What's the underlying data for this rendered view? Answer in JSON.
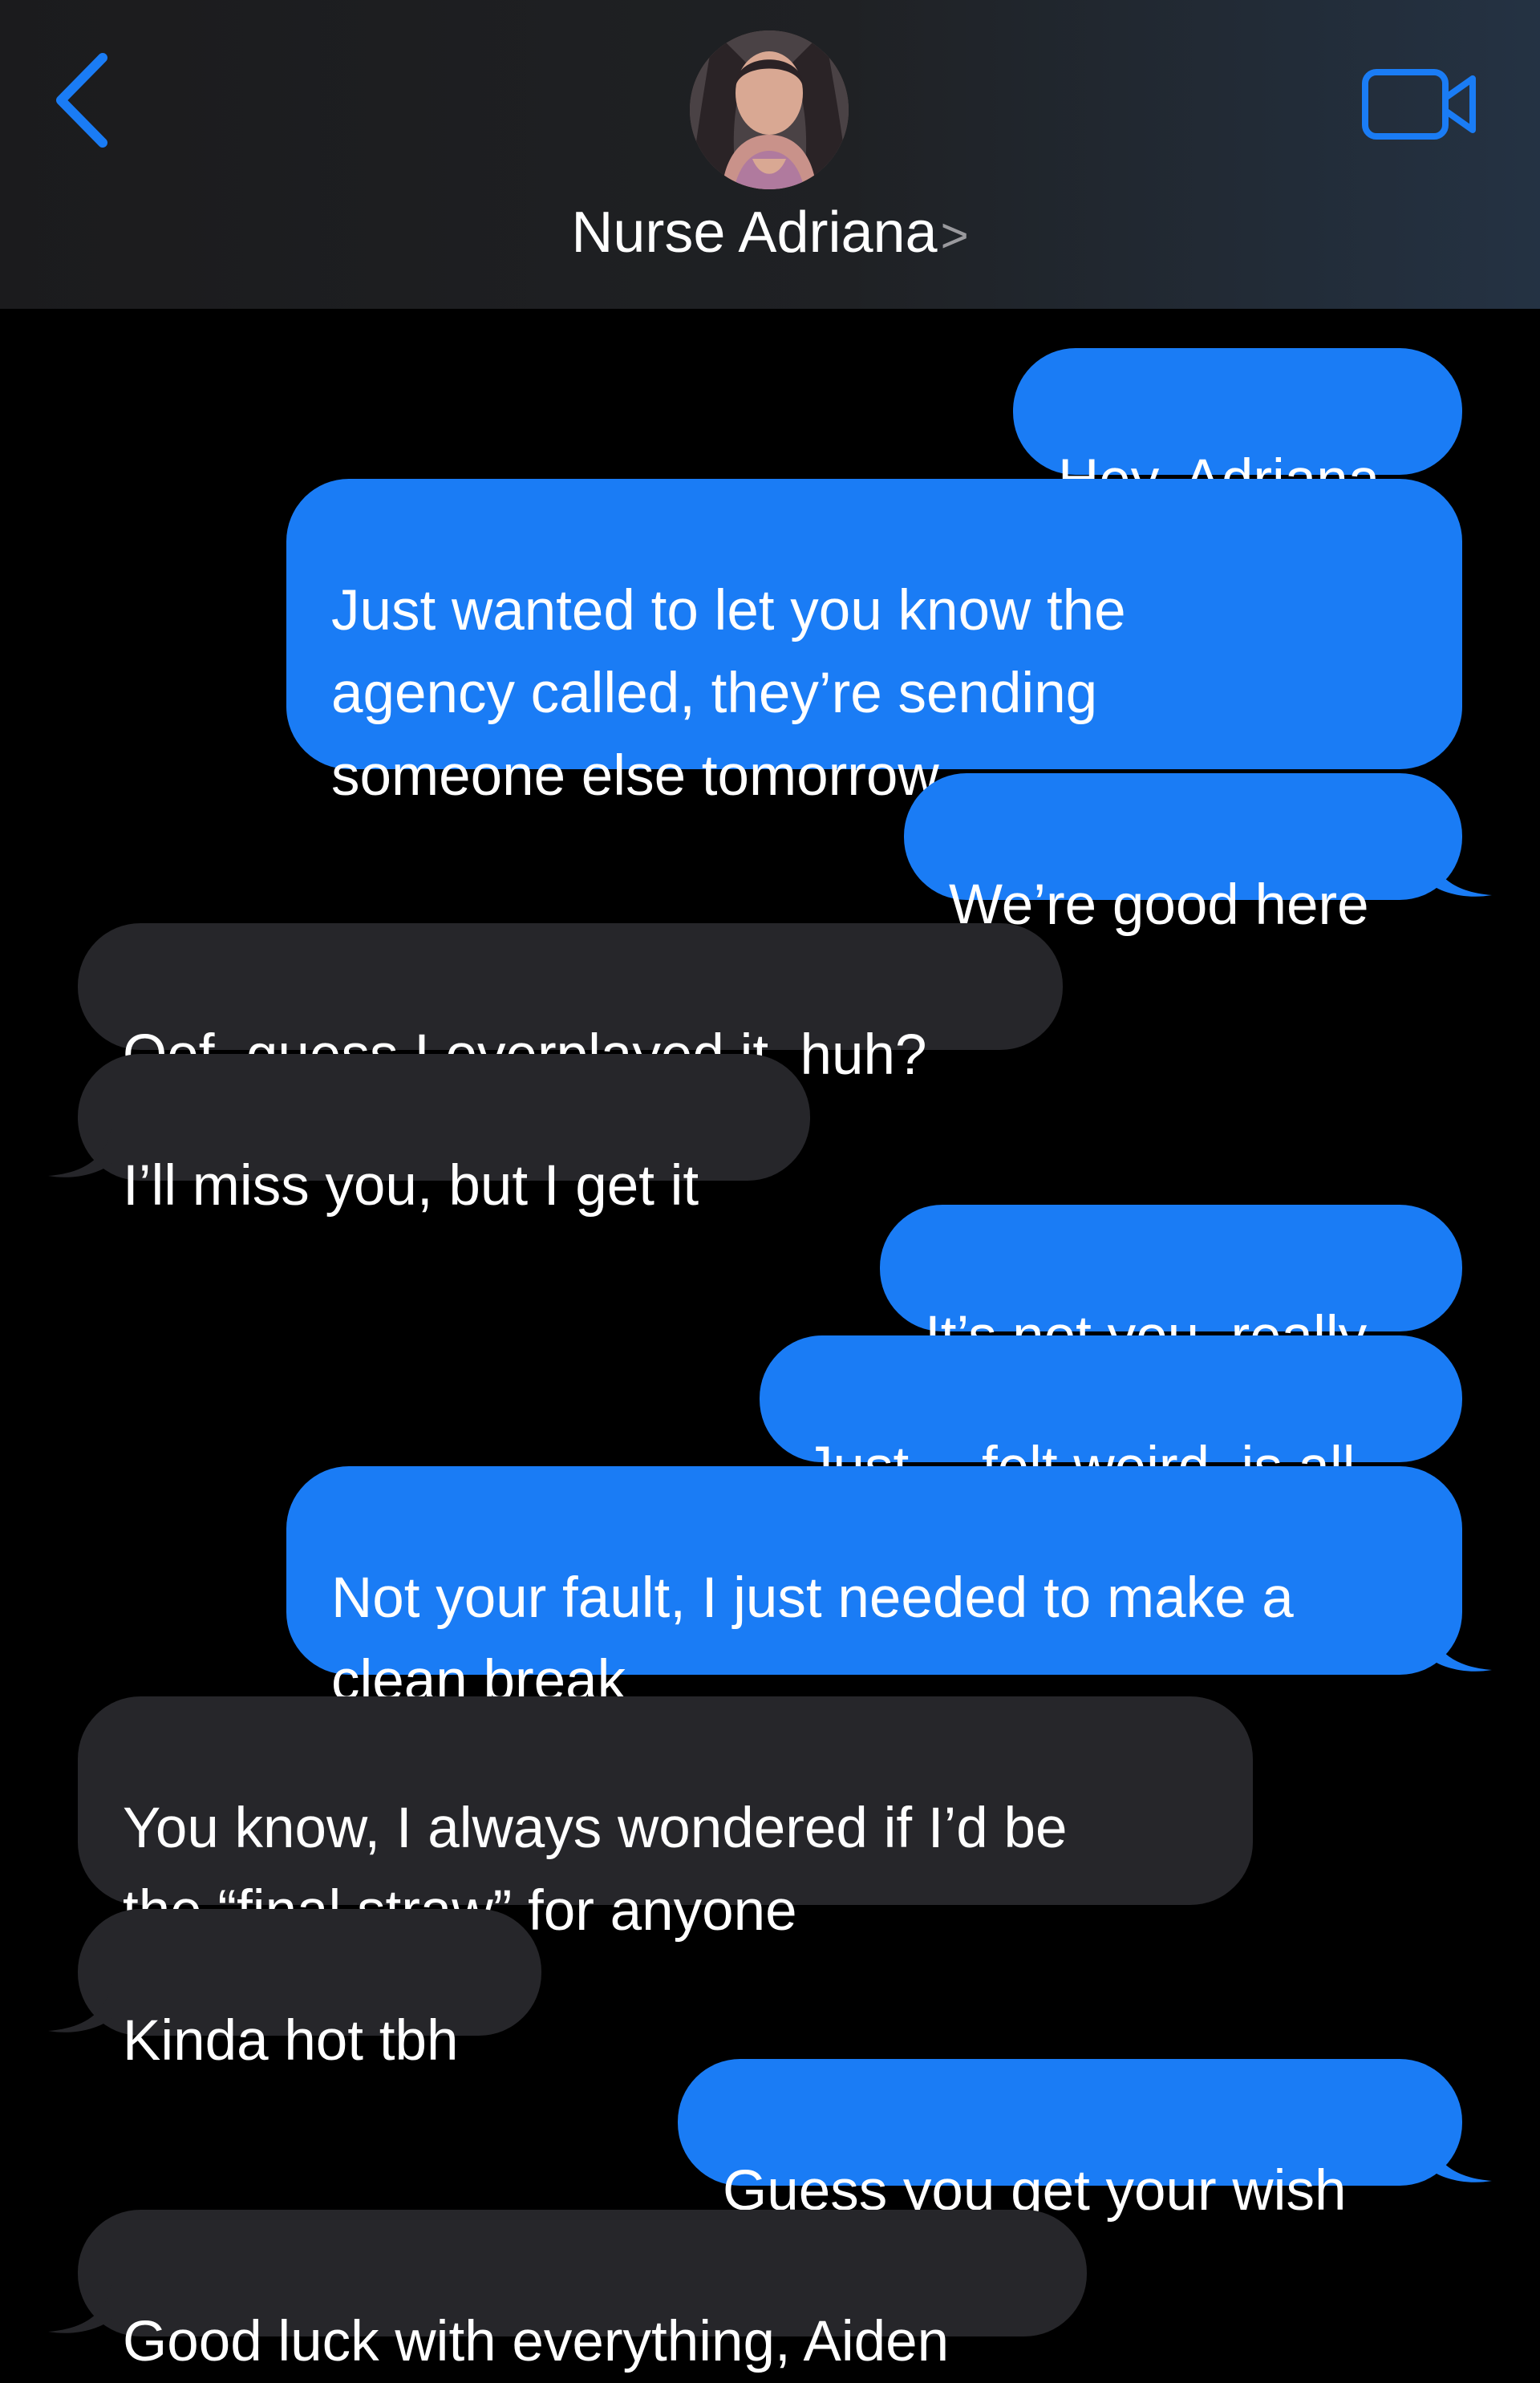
{
  "header": {
    "back_label": "<",
    "contact_name": "Nurse Adriana",
    "contact_chevron": ">",
    "video_icon": "video-camera-icon",
    "accent_color": "#1a7cf5"
  },
  "messages": [
    {
      "from": "me",
      "text": "Hey, Adriana"
    },
    {
      "from": "me",
      "text": "Just wanted to let you know the\nagency called, they’re sending\nsomeone else tomorrow"
    },
    {
      "from": "me",
      "text": "We’re good here"
    },
    {
      "from": "them",
      "text": "Oof, guess I overplayed it, huh?"
    },
    {
      "from": "them",
      "text": "I’ll miss you, but I get it"
    },
    {
      "from": "me",
      "text": "It’s not you, really"
    },
    {
      "from": "me",
      "text": "Just… felt weird, is all"
    },
    {
      "from": "me",
      "text": "Not your fault, I just needed to make a\nclean break"
    },
    {
      "from": "them",
      "text": "You know, I always wondered if I’d be\nthe “final straw” for anyone"
    },
    {
      "from": "them",
      "text": "Kinda hot tbh"
    },
    {
      "from": "me",
      "text": "Guess you get your wish"
    },
    {
      "from": "them",
      "text": "Good luck with everything, Aiden"
    }
  ],
  "colors": {
    "sent_bubble": "#1a7cf5",
    "received_bubble": "#26262a",
    "background": "#000000"
  }
}
